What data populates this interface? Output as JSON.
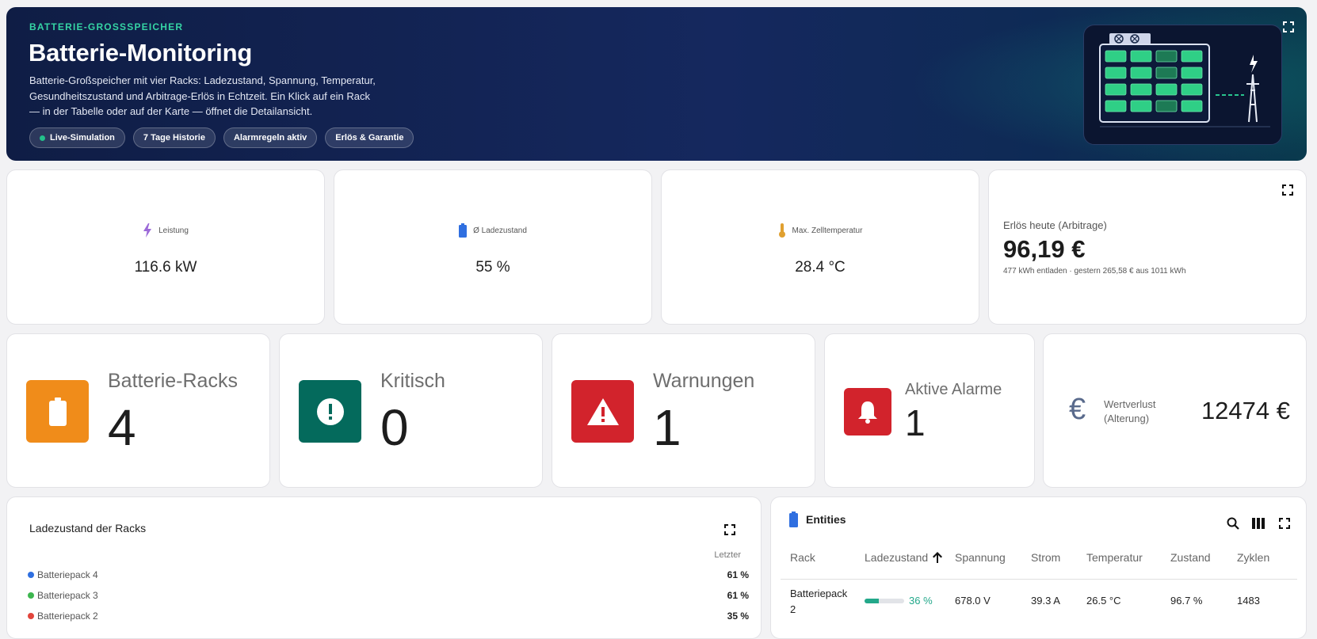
{
  "hero": {
    "eyebrow": "BATTERIE-GROSSSPEICHER",
    "title": "Batterie-Monitoring",
    "description": "Batterie-Großspeicher mit vier Racks: Ladezustand, Spannung, Temperatur, Gesundheitszustand und Arbitrage-Erlös in Echtzeit. Ein Klick auf ein Rack — in der Tabelle oder auf der Karte — öffnet die Detailansicht.",
    "chips": [
      "Live-Simulation",
      "7 Tage Historie",
      "Alarmregeln aktiv",
      "Erlös & Garantie"
    ]
  },
  "stats_top": [
    {
      "label": "Leistung",
      "value": "116.6 kW",
      "icon": "bolt-icon",
      "color": "#9c6ad8"
    },
    {
      "label": "Ø Ladezustand",
      "value": "55 %",
      "icon": "battery-icon",
      "color": "#2f6fe0"
    },
    {
      "label": "Max. Zelltemperatur",
      "value": "28.4 °C",
      "icon": "thermometer-icon",
      "color": "#e0a030"
    }
  ],
  "revenue": {
    "title": "Erlös heute (Arbitrage)",
    "value": "96,19 €",
    "sub": "477 kWh entladen · gestern 265,58 € aus 1011 kWh"
  },
  "stats_mid": [
    {
      "title": "Batterie-Racks",
      "value": "4",
      "icon": "battery-icon",
      "color": "#f08c1a"
    },
    {
      "title": "Kritisch",
      "value": "0",
      "icon": "alert-circle-icon",
      "color": "#046a5c"
    },
    {
      "title": "Warnungen",
      "value": "1",
      "icon": "warning-icon",
      "color": "#d2232c"
    },
    {
      "title": "Aktive Alarme",
      "value": "1",
      "icon": "bell-icon",
      "color": "#d2232c"
    }
  ],
  "loss": {
    "label_line1": "Wertverlust",
    "label_line2": "(Alterung)",
    "value": "12474 €",
    "icon": "euro-icon"
  },
  "soc_card": {
    "title": "Ladezustand der Racks",
    "col_header": "Letzter",
    "rows": [
      {
        "name": "Batteriepack 4",
        "value": "61 %",
        "color": "#2f6fe0"
      },
      {
        "name": "Batteriepack 3",
        "value": "61 %",
        "color": "#3db64f"
      },
      {
        "name": "Batteriepack 2",
        "value": "35 %",
        "color": "#e2453c"
      }
    ]
  },
  "entities": {
    "title": "Entities",
    "columns": [
      "Rack",
      "Ladezustand",
      "Spannung",
      "Strom",
      "Temperatur",
      "Zustand",
      "Zyklen"
    ],
    "rows": [
      {
        "rack_line1": "Batteriepack",
        "rack_line2": "2",
        "soc": "36 %",
        "soc_fraction": 0.36,
        "voltage": "678.0 V",
        "current": "39.3 A",
        "temperature": "26.5 °C",
        "health": "96.7 %",
        "cycles": "1483"
      }
    ]
  }
}
